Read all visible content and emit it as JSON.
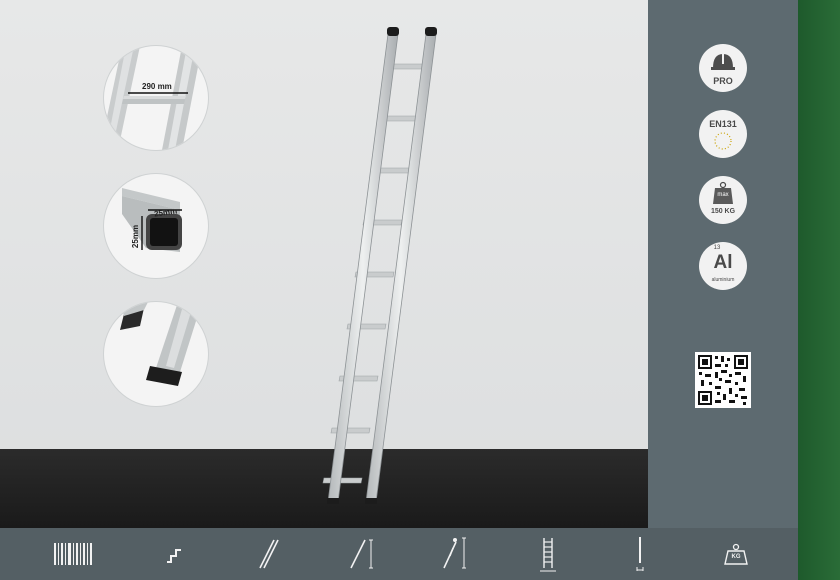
{
  "details": {
    "rung_width": "290 mm",
    "profile_w": "25mm",
    "profile_h": "25mm"
  },
  "badges": {
    "pro": "PRO",
    "norm": "EN131",
    "load_label": "max",
    "load_value": "150 KG",
    "element_number": "13",
    "element_symbol": "Al",
    "element_name": "aluminium"
  },
  "bottom_icons": [
    "barcode-icon",
    "steps-icon",
    "single-section-icon",
    "ladder-height-icon",
    "working-height-icon",
    "rungs-count-icon",
    "length-icon",
    "weight-icon"
  ],
  "bottom_labels": {
    "weight": "KG"
  },
  "colors": {
    "side_panel": "#5d6a70",
    "bottom_bar": "#545f64",
    "green_strip": "#276634",
    "floor": "#222222"
  }
}
